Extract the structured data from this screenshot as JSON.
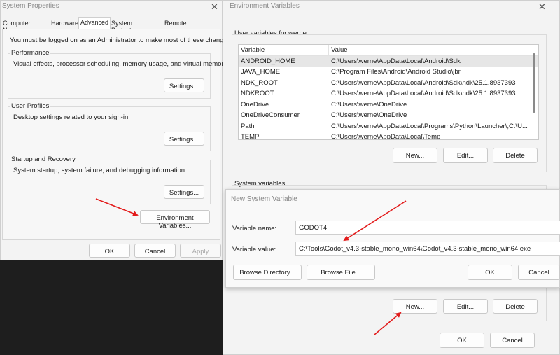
{
  "system_properties": {
    "title": "System Properties",
    "tabs": [
      "Computer Name",
      "Hardware",
      "Advanced",
      "System Protection",
      "Remote"
    ],
    "admin_note": "You must be logged on as an Administrator to make most of these changes.",
    "performance": {
      "label": "Performance",
      "desc": "Visual effects, processor scheduling, memory usage, and virtual memory",
      "button": "Settings..."
    },
    "user_profiles": {
      "label": "User Profiles",
      "desc": "Desktop settings related to your sign-in",
      "button": "Settings..."
    },
    "startup": {
      "label": "Startup and Recovery",
      "desc": "System startup, system failure, and debugging information",
      "button": "Settings..."
    },
    "env_button": "Environment Variables...",
    "ok": "OK",
    "cancel": "Cancel",
    "apply": "Apply"
  },
  "env_vars": {
    "title": "Environment Variables",
    "user_section": "User variables for werne",
    "col_variable": "Variable",
    "col_value": "Value",
    "user_rows": [
      {
        "name": "ANDROID_HOME",
        "value": "C:\\Users\\werne\\AppData\\Local\\Android\\Sdk"
      },
      {
        "name": "JAVA_HOME",
        "value": "C:\\Program Files\\Android\\Android Studio\\jbr"
      },
      {
        "name": "NDK_ROOT",
        "value": "C:\\Users\\werne\\AppData\\Local\\Android\\Sdk\\ndk\\25.1.8937393"
      },
      {
        "name": "NDKROOT",
        "value": "C:\\Users\\werne\\AppData\\Local\\Android\\Sdk\\ndk\\25.1.8937393"
      },
      {
        "name": "OneDrive",
        "value": "C:\\Users\\werne\\OneDrive"
      },
      {
        "name": "OneDriveConsumer",
        "value": "C:\\Users\\werne\\OneDrive"
      },
      {
        "name": "Path",
        "value": "C:\\Users\\werne\\AppData\\Local\\Programs\\Python\\Launcher\\;C:\\U..."
      },
      {
        "name": "TEMP",
        "value": "C:\\Users\\werne\\AppData\\Local\\Temp"
      }
    ],
    "user_new": "New...",
    "user_edit": "Edit...",
    "user_delete": "Delete",
    "system_section": "System variables",
    "sys_new": "New...",
    "sys_edit": "Edit...",
    "sys_delete": "Delete",
    "ok": "OK",
    "cancel": "Cancel"
  },
  "new_var": {
    "title": "New System Variable",
    "name_label": "Variable name:",
    "name_value": "GODOT4",
    "value_label": "Variable value:",
    "value_value": "C:\\Tools\\Godot_v4.3-stable_mono_win64\\Godot_v4.3-stable_mono_win64.exe",
    "browse_dir": "Browse Directory...",
    "browse_file": "Browse File...",
    "ok": "OK",
    "cancel": "Cancel"
  },
  "colors": {
    "arrow": "#e31b1b",
    "window_bg": "#f3f3f3",
    "selected_row": "#e6e6e6"
  },
  "icons": {
    "close": "close-icon",
    "arrow": "red-annotation-arrow"
  }
}
